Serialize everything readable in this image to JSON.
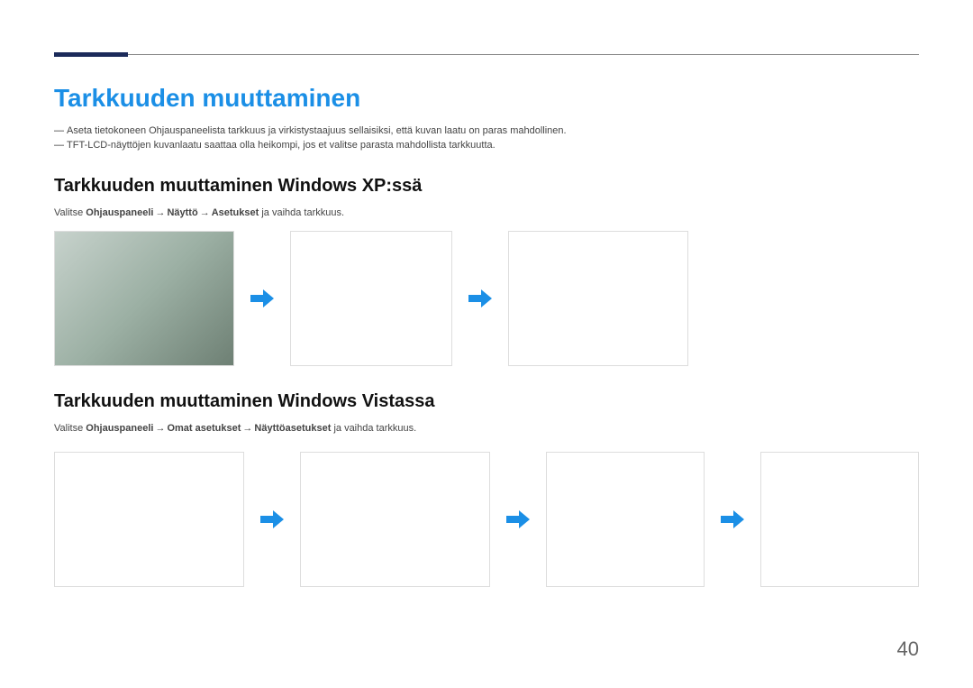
{
  "heading_main": "Tarkkuuden muuttaminen",
  "notes": [
    "Aseta tietokoneen Ohjauspaneelista tarkkuus ja virkistystaajuus sellaisiksi, että kuvan laatu on paras mahdollinen.",
    "TFT-LCD-näyttöjen kuvanlaatu saattaa olla heikompi, jos et valitse parasta mahdollista tarkkuutta."
  ],
  "xp": {
    "heading": "Tarkkuuden muuttaminen Windows XP:ssä",
    "instr_prefix": "Valitse ",
    "path_1": "Ohjauspaneeli",
    "path_2": "Näyttö",
    "path_3": "Asetukset",
    "instr_suffix": " ja vaihda tarkkuus.",
    "arrow": "→"
  },
  "vista": {
    "heading": "Tarkkuuden muuttaminen Windows Vistassa",
    "instr_prefix": "Valitse ",
    "path_1": "Ohjauspaneeli",
    "path_2": "Omat asetukset",
    "path_3": "Näyttöasetukset",
    "instr_suffix": " ja vaihda tarkkuus.",
    "arrow": "→"
  },
  "page_number": "40"
}
